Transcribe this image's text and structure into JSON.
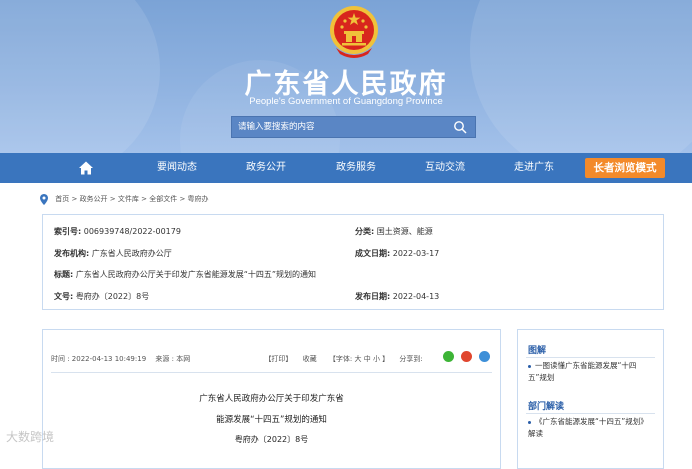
{
  "header": {
    "title": "广东省人民政府",
    "subtitle": "People's Government of Guangdong Province",
    "search_placeholder": "请输入要搜索的内容"
  },
  "nav": {
    "items": [
      "要闻动态",
      "政务公开",
      "政务服务",
      "互动交流",
      "走进广东"
    ],
    "elder_mode": "长者浏览模式"
  },
  "breadcrumb": [
    "首页",
    "政务公开",
    "文件库",
    "全部文件",
    "粤府办"
  ],
  "meta": {
    "index_label": "索引号:",
    "index_value": "006939748/2022-00179",
    "category_label": "分类:",
    "category_value": "国土资源、能源",
    "issuer_label": "发布机构:",
    "issuer_value": "广东省人民政府办公厅",
    "created_label": "成文日期:",
    "created_value": "2022-03-17",
    "title_label": "标题:",
    "title_value": "广东省人民政府办公厅关于印发广东省能源发展“十四五”规划的通知",
    "docno_label": "文号:",
    "docno_value": "粤府办〔2022〕8号",
    "published_label": "发布日期:",
    "published_value": "2022-04-13"
  },
  "article": {
    "time": "时间 : 2022-04-13 10:49:19",
    "source": "来源 : 本网",
    "print": "【打印】",
    "favorite": "收藏",
    "font_size": "【字体: 大   中   小 】",
    "share": "分享到:",
    "title_line1": "广东省人民政府办公厅关于印发广东省",
    "title_line2": "能源发展“十四五”规划的通知",
    "docno": "粤府办〔2022〕8号"
  },
  "sidebar": {
    "graphic_heading": "图解",
    "graphic_item": "一图读懂广东省能源发展“十四五”规划",
    "interpret_heading": "部门解读",
    "interpret_item": "《广东省能源发展“十四五”规划》解读"
  },
  "watermark": "大数跨境",
  "colors": {
    "nav_bg": "#3a75be",
    "elder_button": "#f38a2a",
    "accent_text": "#2a5ea8"
  }
}
